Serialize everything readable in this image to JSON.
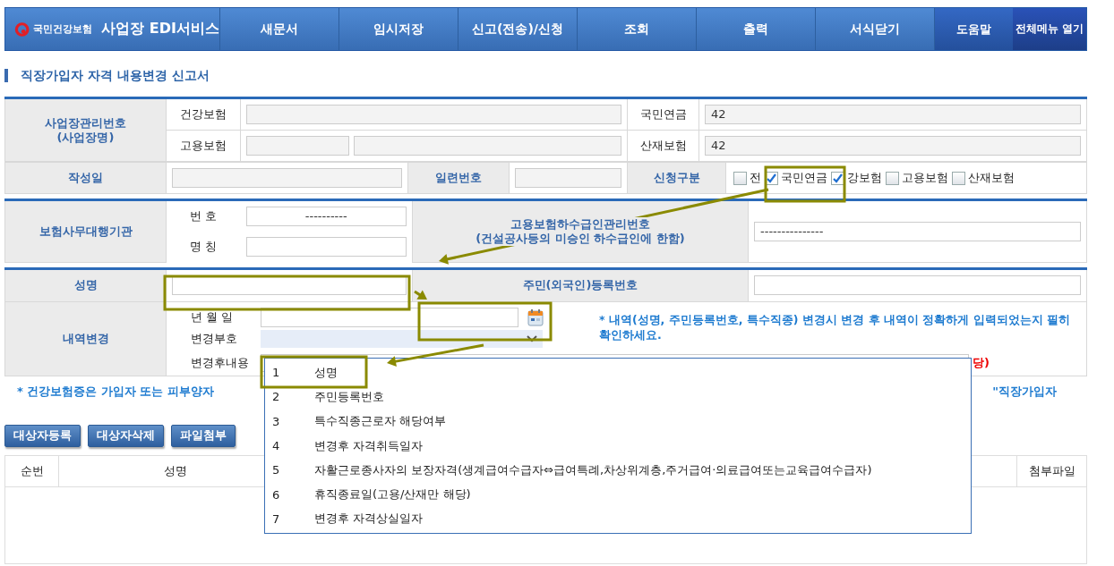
{
  "header": {
    "logo_text": "국민건강보험",
    "title": "사업장 EDI서비스",
    "menu": [
      {
        "label": "새문서",
        "kind": "main"
      },
      {
        "label": "임시저장",
        "kind": "main"
      },
      {
        "label": "신고(전송)/신청",
        "kind": "main"
      },
      {
        "label": "조회",
        "kind": "main"
      },
      {
        "label": "출력",
        "kind": "main"
      },
      {
        "label": "서식닫기",
        "kind": "main"
      },
      {
        "label": "도움말",
        "kind": "help"
      },
      {
        "label": "전체메뉴 열기",
        "kind": "all"
      }
    ]
  },
  "form_title": "직장가입자 자격 내용변경 신고서",
  "workplace": {
    "label": [
      "사업장관리번호",
      "(사업장명)"
    ],
    "insurances": [
      {
        "label": "건강보험"
      },
      {
        "label": "국민연금",
        "value": "42"
      },
      {
        "label": "고용보험"
      },
      {
        "label": "산재보험",
        "value": "42"
      }
    ],
    "written_date_label": "작성일",
    "serial_label": "일련번호",
    "apply_label": "신청구분",
    "apply_options": [
      {
        "label": "전",
        "checked": false
      },
      {
        "label": "국민연금",
        "checked": true
      },
      {
        "label": "강보험",
        "checked": true
      },
      {
        "label": "고용보험",
        "checked": false
      },
      {
        "label": "산재보험",
        "checked": false
      }
    ]
  },
  "agency": {
    "label": "보험사무대행기관",
    "number_label": "번 호",
    "number_value": "----------",
    "name_label": "명 칭",
    "sub_label": [
      "고용보험하수급인관리번호",
      "(건설공사등의 미승인 하수급인에 한함)"
    ],
    "sub_value": "---------------"
  },
  "person": {
    "name_label": "성명",
    "resident_label": "주민(외국인)등록번호"
  },
  "change": {
    "label": "내역변경",
    "date_label": "년 월 일",
    "code_label": "변경부호",
    "content_label": "변경후내용",
    "note": "* 내역(성명, 주민등록번호, 특수직종) 변경시 변경 후 내역이 정확하게 입력되었는지 필히 확인하세요.",
    "red_tail": "당)"
  },
  "notice": [
    "* 건강보험증은 가입자 또는 피부양자",
    "\"직장가입자"
  ],
  "buttons": [
    "대상자등록",
    "대상자삭제",
    "파일첨부"
  ],
  "list_columns": [
    "순번",
    "성명",
    "첨부파일"
  ],
  "dropdown": [
    {
      "code": "1",
      "text": "성명"
    },
    {
      "code": "2",
      "text": "주민등록번호"
    },
    {
      "code": "3",
      "text": "특수직종근로자 해당여부"
    },
    {
      "code": "4",
      "text": "변경후 자격취득일자"
    },
    {
      "code": "5",
      "text": "자활근로종사자의 보장자격(생계급여수급자⇔급여특례,차상위계층,주거급여·의료급여또는교육급여수급자)"
    },
    {
      "code": "6",
      "text": "휴직종료일(고용/산재만 해당)"
    },
    {
      "code": "7",
      "text": "변경후 자격상실일자"
    }
  ]
}
